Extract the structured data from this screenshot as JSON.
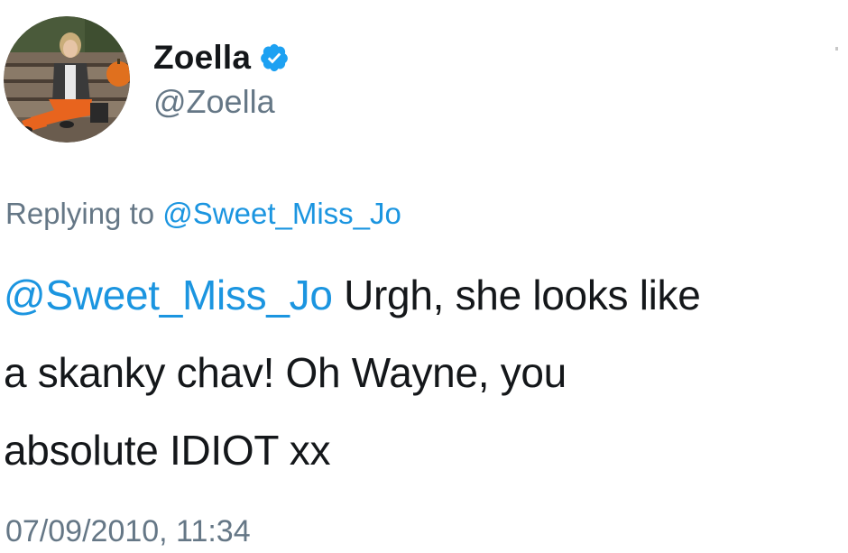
{
  "tweet": {
    "author": {
      "display_name": "Zoella",
      "handle": "@Zoella",
      "verified": true,
      "avatar_icon": "profile-photo"
    },
    "replying_prefix": "Replying to",
    "replying_to": "@Sweet_Miss_Jo",
    "mention": "@Sweet_Miss_Jo",
    "body_line1": " Urgh, she looks like",
    "body_line2": "a skanky chav! Oh Wayne, you",
    "body_line3": "absolute IDIOT xx",
    "timestamp": "07/09/2010, 11:34"
  },
  "colors": {
    "link": "#1b95e0",
    "secondary_text": "#657786",
    "primary_text": "#14171a",
    "verified_badge": "#1da1f2"
  }
}
